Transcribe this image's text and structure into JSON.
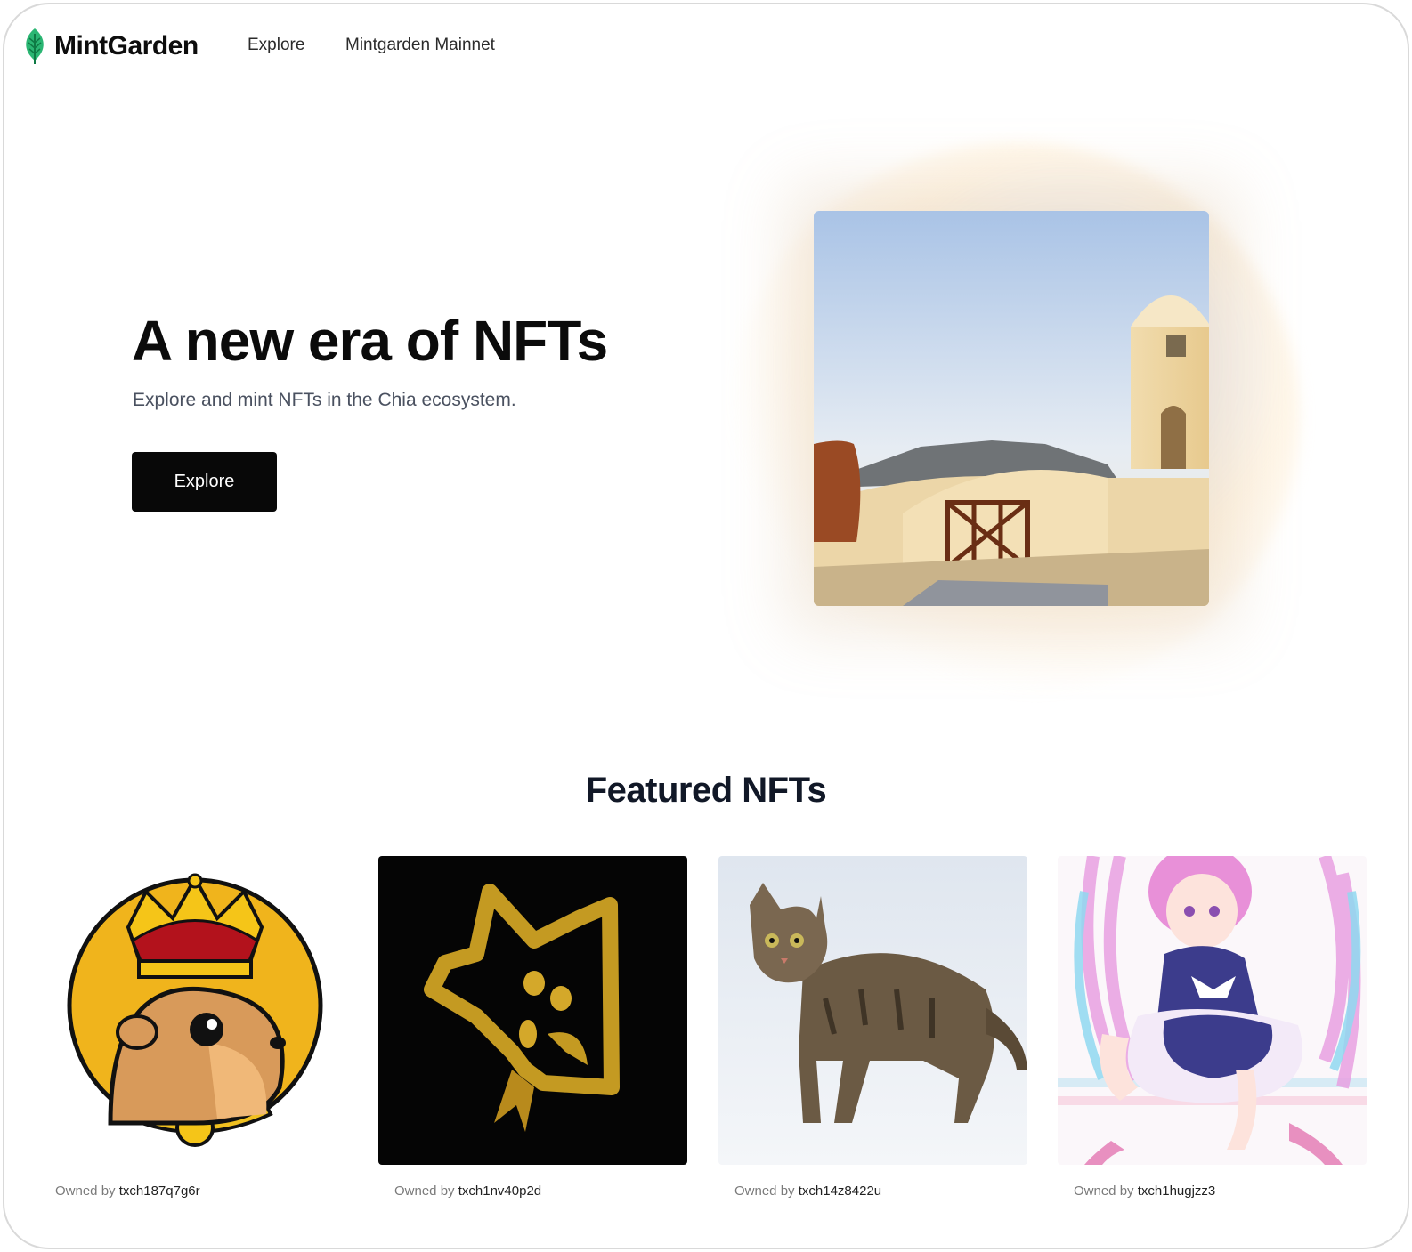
{
  "header": {
    "brand": "MintGarden",
    "nav": [
      "Explore",
      "Mintgarden Mainnet"
    ]
  },
  "hero": {
    "title": "A new era of NFTs",
    "subtitle": "Explore and mint NFTs in the Chia ecosystem.",
    "button_label": "Explore"
  },
  "featured": {
    "title": "Featured NFTs",
    "owned_prefix": "Owned by",
    "cards": [
      {
        "owner": "txch187q7g6r",
        "image": "crowned-gopher-emblem"
      },
      {
        "owner": "txch1nv40p2d",
        "image": "gold-cat-mask"
      },
      {
        "owner": "txch14z8422u",
        "image": "tabby-cat-in-snow"
      },
      {
        "owner": "txch1hugjzz3",
        "image": "anime-maid-girl"
      }
    ]
  },
  "colors": {
    "brand_leaf": "#2bb673",
    "button_bg": "#080808",
    "gopher_badge": "#f0b41c"
  }
}
